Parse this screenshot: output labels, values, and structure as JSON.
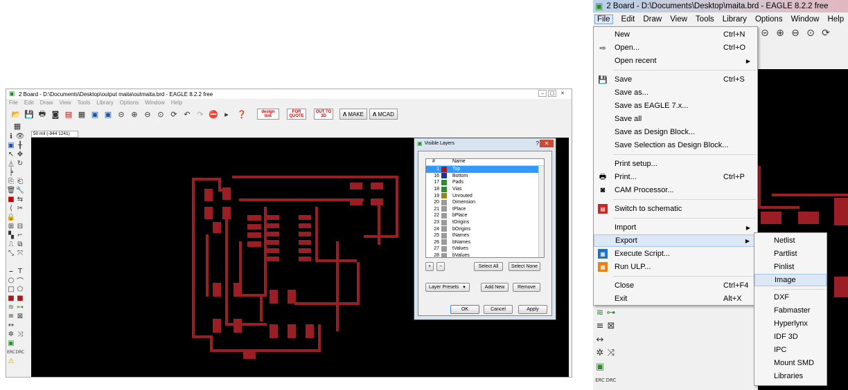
{
  "left_window": {
    "title": "2 Board - D:\\Documents\\Desktop\\output maita\\outmaita.brd - EAGLE 8.2.2 free",
    "menu": [
      "File",
      "Edit",
      "Draw",
      "View",
      "Tools",
      "Library",
      "Options",
      "Window",
      "Help"
    ],
    "coord_readout": "50 mil (-844 1241)",
    "toolbar_buttons": [
      {
        "label": "MAKE",
        "icon": "make-icon"
      },
      {
        "label": "MCAD",
        "icon": "mcad-icon"
      }
    ],
    "red_buttons": [
      "design link",
      "FOR QUOTE",
      "OUT TO 3D"
    ]
  },
  "layers_dialog": {
    "title": "Visible Layers",
    "col_num": "#",
    "col_name": "Name",
    "layers": [
      {
        "num": "1",
        "name": "Top",
        "color": "#9a1e24",
        "selected": true
      },
      {
        "num": "16",
        "name": "Bottom",
        "color": "#1f2fa0"
      },
      {
        "num": "17",
        "name": "Pads",
        "color": "#2e8b2e"
      },
      {
        "num": "18",
        "name": "Vias",
        "color": "#2e8b2e"
      },
      {
        "num": "19",
        "name": "Unrouted",
        "color": "#8a8a1e"
      },
      {
        "num": "20",
        "name": "Dimension",
        "color": "#9a9a9a"
      },
      {
        "num": "21",
        "name": "tPlace",
        "color": "#9a9a9a"
      },
      {
        "num": "22",
        "name": "bPlace",
        "color": "#9a9a9a"
      },
      {
        "num": "23",
        "name": "tOrigins",
        "color": "#9a9a9a"
      },
      {
        "num": "24",
        "name": "bOrigins",
        "color": "#9a9a9a"
      },
      {
        "num": "25",
        "name": "tNames",
        "color": "#9a9a9a"
      },
      {
        "num": "26",
        "name": "bNames",
        "color": "#9a9a9a"
      },
      {
        "num": "27",
        "name": "tValues",
        "color": "#9a9a9a"
      },
      {
        "num": "28",
        "name": "bValues",
        "color": "#9a9a9a"
      }
    ],
    "plus": "+",
    "minus": "−",
    "select_all": "Select All",
    "select_none": "Select None",
    "layer_presets": "Layer Presets",
    "add_new": "Add New",
    "remove": "Remove",
    "ok": "OK",
    "cancel": "Cancel",
    "apply": "Apply"
  },
  "right_window": {
    "title": "2 Board - D:\\Documents\\Desktop\\maita.brd - EAGLE 8.2.2 free",
    "menu": [
      "File",
      "Edit",
      "Draw",
      "View",
      "Tools",
      "Library",
      "Options",
      "Window",
      "Help"
    ]
  },
  "file_menu": {
    "items": [
      {
        "label": "New",
        "shortcut": "Ctrl+N"
      },
      {
        "label": "Open...",
        "shortcut": "Ctrl+O",
        "icon": "open-icon"
      },
      {
        "label": "Open recent",
        "submenu": true
      },
      {
        "sep": true
      },
      {
        "label": "Save",
        "shortcut": "Ctrl+S",
        "icon": "save-icon"
      },
      {
        "label": "Save as..."
      },
      {
        "label": "Save as EAGLE 7.x..."
      },
      {
        "label": "Save all"
      },
      {
        "label": "Save as Design Block..."
      },
      {
        "label": "Save Selection as Design Block..."
      },
      {
        "sep": true
      },
      {
        "label": "Print setup..."
      },
      {
        "label": "Print...",
        "shortcut": "Ctrl+P",
        "icon": "print-icon"
      },
      {
        "label": "CAM Processor...",
        "icon": "cam-icon"
      },
      {
        "sep": true
      },
      {
        "label": "Switch to schematic",
        "icon": "schematic-icon"
      },
      {
        "sep": true
      },
      {
        "label": "Import",
        "submenu": true
      },
      {
        "label": "Export",
        "submenu": true,
        "highlighted": true
      },
      {
        "label": "Execute Script...",
        "icon": "script-icon"
      },
      {
        "label": "Run ULP...",
        "icon": "ulp-icon"
      },
      {
        "sep": true
      },
      {
        "label": "Close",
        "shortcut": "Ctrl+F4"
      },
      {
        "label": "Exit",
        "shortcut": "Alt+X"
      }
    ]
  },
  "export_menu": {
    "items": [
      {
        "label": "Netlist"
      },
      {
        "label": "Partlist"
      },
      {
        "label": "Pinlist"
      },
      {
        "label": "Image",
        "highlighted": true
      },
      {
        "sep": true
      },
      {
        "label": "DXF"
      },
      {
        "label": "Fabmaster"
      },
      {
        "label": "Hyperlynx"
      },
      {
        "label": "IDF 3D"
      },
      {
        "label": "IPC"
      },
      {
        "label": "Mount SMD"
      },
      {
        "label": "Libraries"
      }
    ]
  },
  "colors": {
    "pcb_trace": "#9a1e24",
    "canvas": "#000000",
    "menu_highlight": "#dde8f6",
    "layer_selection": "#3399ff"
  }
}
